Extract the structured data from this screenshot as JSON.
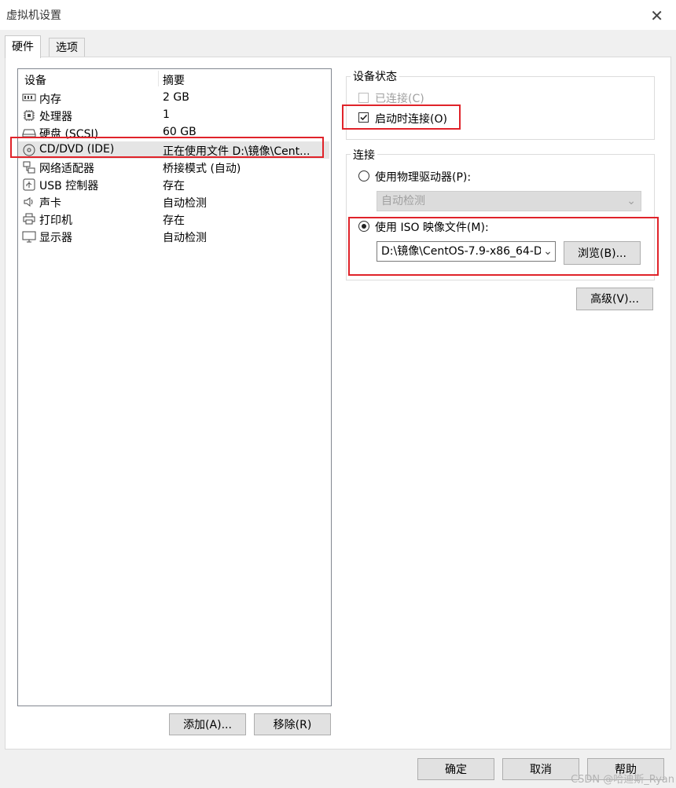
{
  "window": {
    "title": "虚拟机设置"
  },
  "tabs": [
    {
      "label": "硬件"
    },
    {
      "label": "选项"
    }
  ],
  "device_list": {
    "headers": {
      "device": "设备",
      "summary": "摘要"
    },
    "rows": [
      {
        "icon": "memory-icon",
        "name": "内存",
        "summary": "2 GB"
      },
      {
        "icon": "processor-icon",
        "name": "处理器",
        "summary": "1"
      },
      {
        "icon": "harddisk-icon",
        "name": "硬盘 (SCSI)",
        "summary": "60 GB"
      },
      {
        "icon": "cd-dvd-icon",
        "name": "CD/DVD (IDE)",
        "summary": "正在使用文件 D:\\镜像\\Cent..."
      },
      {
        "icon": "network-adapter-icon",
        "name": "网络适配器",
        "summary": "桥接模式 (自动)"
      },
      {
        "icon": "usb-icon",
        "name": "USB 控制器",
        "summary": "存在"
      },
      {
        "icon": "sound-icon",
        "name": "声卡",
        "summary": "自动检测"
      },
      {
        "icon": "printer-icon",
        "name": "打印机",
        "summary": "存在"
      },
      {
        "icon": "display-icon",
        "name": "显示器",
        "summary": "自动检测"
      }
    ],
    "selected_index": 3
  },
  "list_buttons": {
    "add": "添加(A)...",
    "remove": "移除(R)"
  },
  "device_status": {
    "label": "设备状态",
    "connected": {
      "label": "已连接(C)",
      "checked": false,
      "disabled": true
    },
    "connect_at_power_on": {
      "label": "启动时连接(O)",
      "checked": true
    }
  },
  "connection": {
    "label": "连接",
    "physical_drive": {
      "label": "使用物理驱动器(P):",
      "selected": false,
      "dropdown_value": "自动检测"
    },
    "iso_image": {
      "label": "使用 ISO 映像文件(M):",
      "selected": true,
      "path_value": "D:\\镜像\\CentOS-7.9-x86_64-D",
      "browse_label": "浏览(B)..."
    }
  },
  "advanced_label": "高级(V)...",
  "footer": {
    "ok": "确定",
    "cancel": "取消",
    "help": "帮助"
  },
  "watermark": "CSDN @哈迪斯_Ryan",
  "colors": {
    "highlight": "#e0232a",
    "selected_row": "#e5e5e5"
  }
}
